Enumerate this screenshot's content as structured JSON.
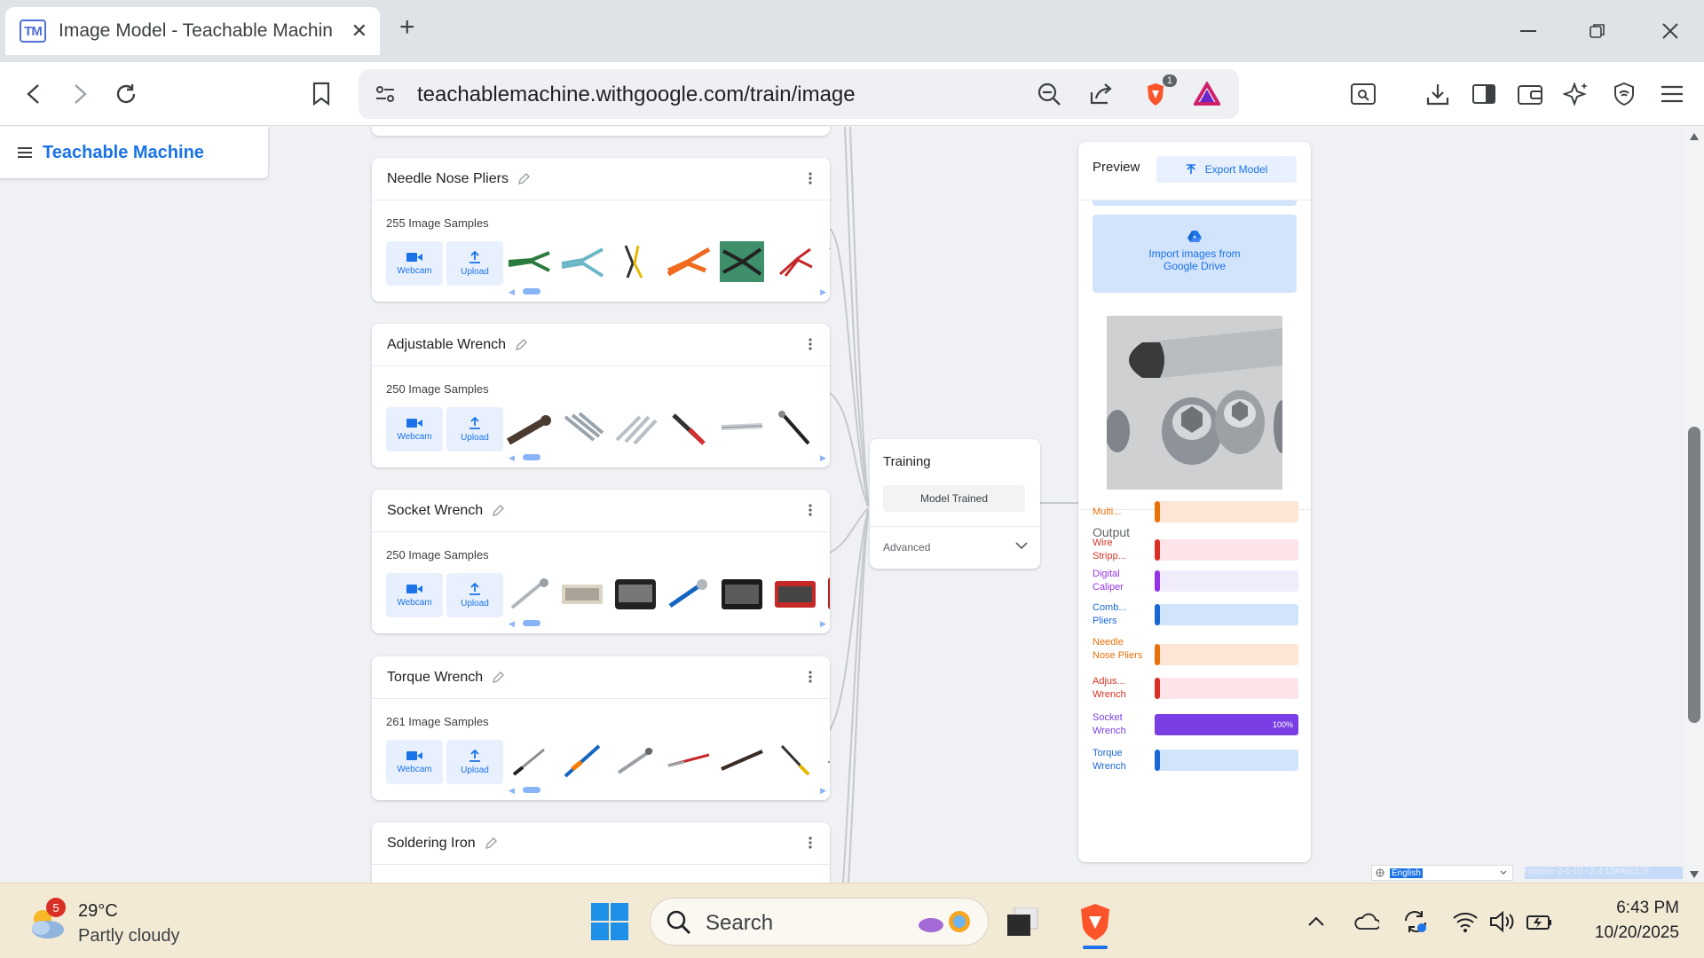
{
  "browser": {
    "tab_title": "Image Model - Teachable Machine",
    "tab_favicon": "TM",
    "url": "teachablemachine.withgoogle.com/train/image",
    "brave_shield_count": "1"
  },
  "app": {
    "name": "Teachable Machine"
  },
  "classes": [
    {
      "name": "Needle Nose Pliers",
      "samples": "255 Image Samples"
    },
    {
      "name": "Adjustable Wrench",
      "samples": "250 Image Samples"
    },
    {
      "name": "Socket Wrench",
      "samples": "250 Image Samples"
    },
    {
      "name": "Torque Wrench",
      "samples": "261 Image Samples"
    },
    {
      "name": "Soldering Iron",
      "samples": ""
    }
  ],
  "buttons": {
    "webcam": "Webcam",
    "upload": "Upload"
  },
  "training": {
    "title": "Training",
    "status_button": "Model Trained",
    "advanced": "Advanced"
  },
  "preview": {
    "title": "Preview",
    "export": "Export Model",
    "import_line1": "Import images from",
    "import_line2": "Google Drive",
    "output_label": "Output",
    "outputs": [
      {
        "label": "Multi...",
        "color": "#e8710a",
        "track": "#fde6d6",
        "value": 0,
        "value_label": ""
      },
      {
        "label": "Wire Stripp...",
        "color": "#d93025",
        "track": "#fce4e8",
        "value": 0,
        "value_label": ""
      },
      {
        "label": "Digital Caliper",
        "color": "#9334e6",
        "track": "#f1ecfc",
        "value": 0,
        "value_label": ""
      },
      {
        "label": "Comb... Pliers",
        "color": "#1967d2",
        "track": "#d2e3fc",
        "value": 0,
        "value_label": ""
      },
      {
        "label": "Needle Nose Pliers",
        "color": "#e8710a",
        "track": "#fde6d6",
        "value": 0,
        "value_label": ""
      },
      {
        "label": "Adjus... Wrench",
        "color": "#d93025",
        "track": "#fce4e8",
        "value": 0,
        "value_label": ""
      },
      {
        "label": "Socket Wrench",
        "color": "#7a3fe4",
        "track": "#ece3fc",
        "value": 100,
        "value_label": "100%"
      },
      {
        "label": "Torque Wrench",
        "color": "#1967d2",
        "track": "#d2e3fc",
        "value": 0,
        "value_label": ""
      }
    ]
  },
  "footer": {
    "language": "English",
    "release": "release-2-4-10 - 2.4.10#40c178"
  },
  "taskbar": {
    "weather_temp": "29°C",
    "weather_cond": "Partly cloudy",
    "weather_badge": "5",
    "search_placeholder": "Search",
    "time": "6:43 PM",
    "date": "10/20/2025"
  }
}
